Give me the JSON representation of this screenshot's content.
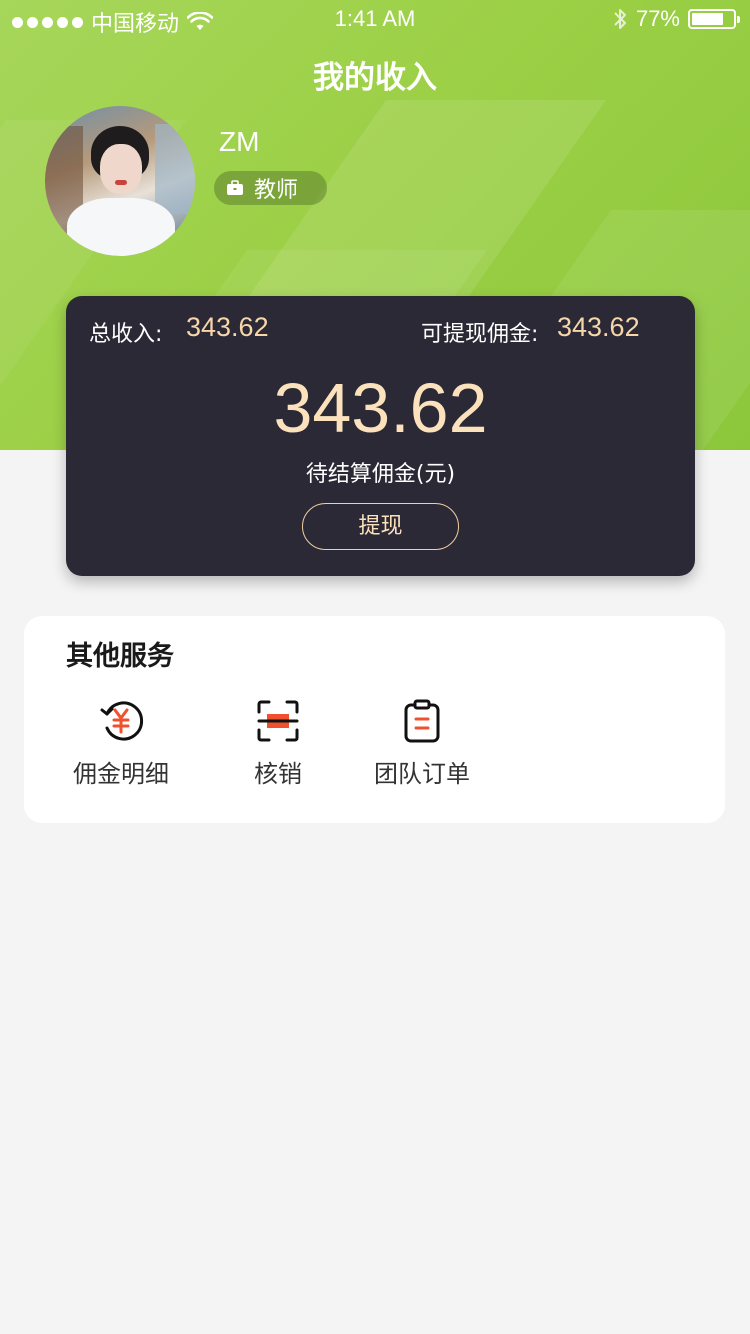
{
  "status_bar": {
    "carrier": "中国移动",
    "time": "1:41 AM",
    "battery_percent": "77%",
    "battery_level": 0.77,
    "signal_icon": "signal-dots-icon",
    "wifi_icon": "wifi-icon",
    "bluetooth_icon": "bluetooth-icon"
  },
  "header": {
    "title": "我的收入"
  },
  "profile": {
    "name": "ZM",
    "role": "教师",
    "role_icon": "briefcase-icon"
  },
  "income": {
    "total_label": "总收入:",
    "total_value": "343.62",
    "withdrawable_label": "可提现佣金:",
    "withdrawable_value": "343.62",
    "pending_value": "343.62",
    "pending_label": "待结算佣金(元)",
    "withdraw_button": "提现"
  },
  "services": {
    "title": "其他服务",
    "items": [
      {
        "label": "佣金明细",
        "icon": "commission-yen-icon"
      },
      {
        "label": "核销",
        "icon": "scan-verify-icon"
      },
      {
        "label": "团队订单",
        "icon": "clipboard-order-icon"
      }
    ]
  },
  "colors": {
    "header_green": "#9cd046",
    "card_dark": "#2a2935",
    "gold": "#f7d6a9",
    "accent_red": "#f0502d"
  }
}
